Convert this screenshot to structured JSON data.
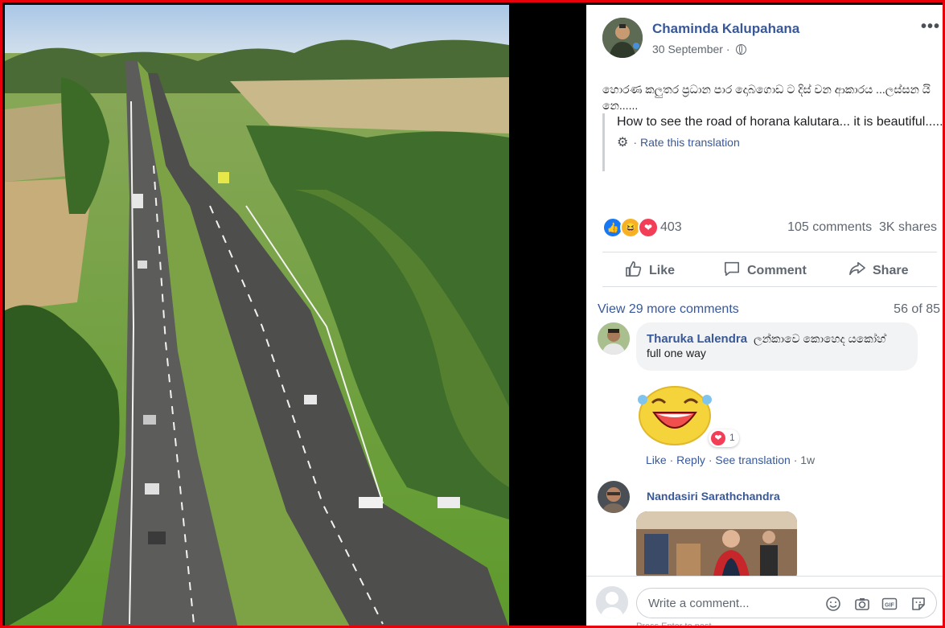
{
  "post": {
    "author": "Chaminda Kalupahana",
    "date": "30 September",
    "date_sep": "·",
    "more_label": "•••",
    "text_original": "හොරණ කලුතර ප්‍රධාන පාර දොබගොඩ ට දිස් වන ආකාරය ...ලස්සන යි නෙ......",
    "translation": "How to see the road of horana kalutara... it is beautiful......",
    "rate_translation": "Rate this translation",
    "rate_sep": "·"
  },
  "stats": {
    "reaction_count": "403",
    "comments": "105 comments",
    "shares": "3K shares"
  },
  "actions": {
    "like": "Like",
    "comment": "Comment",
    "share": "Share"
  },
  "comments_header": {
    "view_more": "View 29 more comments",
    "position": "56 of 85"
  },
  "comments": [
    {
      "name": "Tharuka Lalendra",
      "text": "ලන්කාවෙ කොහෙද යකෝහ්",
      "text2": "full one way",
      "reaction_count": "1",
      "like": "Like",
      "reply": "Reply",
      "see_translation": "See translation",
      "time": "1w",
      "sep": "·"
    },
    {
      "name": "Nandasiri Sarathchandra"
    }
  ],
  "composer": {
    "placeholder": "Write a comment...",
    "hint": "Press Enter to post.",
    "gif_label": "GIF"
  },
  "colors": {
    "frame": "#e8000b",
    "link": "#385898",
    "love": "#f33e58",
    "like": "#1877f2",
    "haha": "#f7b125"
  }
}
